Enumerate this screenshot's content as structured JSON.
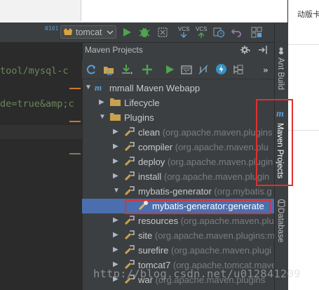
{
  "toolbar": {
    "run_config_label": "tomcat",
    "vcs_label_1": "VCS",
    "vcs_label_2": "VCS"
  },
  "editor": {
    "lines": [
      "tool/mysql-c",
      "de=true&amp;c"
    ]
  },
  "maven_panel": {
    "title": "Maven Projects",
    "tree": {
      "project": "mmall Maven Webapp",
      "lifecycle": "Lifecycle",
      "plugins": "Plugins",
      "items": [
        {
          "name": "clean",
          "detail": "(org.apache.maven.plugins"
        },
        {
          "name": "compiler",
          "detail": "(org.apache.maven.plu"
        },
        {
          "name": "deploy",
          "detail": "(org.apache.maven.plugin"
        },
        {
          "name": "install",
          "detail": "(org.apache.maven.plugin"
        },
        {
          "name": "mybatis-generator",
          "detail": "(org.mybatis.g"
        },
        {
          "name": "mybatis-generator:generate",
          "detail": ""
        },
        {
          "name": "resources",
          "detail": "(org.apache.maven.plu"
        },
        {
          "name": "site",
          "detail": "(org.apache.maven.plugins:m"
        },
        {
          "name": "surefire",
          "detail": "(org.apache.maven.plugi"
        },
        {
          "name": "tomcat7",
          "detail": "(org.apache.tomcat.mave"
        },
        {
          "name": "war",
          "detail": "(org.apache.maven.plugins"
        }
      ]
    }
  },
  "right_strip": {
    "ant_build": "Ant Build",
    "maven_projects": "Maven Projects",
    "database": "Database"
  },
  "far_right": {
    "text": "动版卡"
  },
  "watermark": "http://blog.csdn.net/u012841209",
  "colors": {
    "selection": "#4b6eaf",
    "annotation": "#e03030",
    "run_green": "#4ea54e",
    "code_orange": "#cc7832",
    "code_green": "#6a8759",
    "panel_bg": "#3c3f41",
    "editor_bg": "#2b2b2b"
  }
}
